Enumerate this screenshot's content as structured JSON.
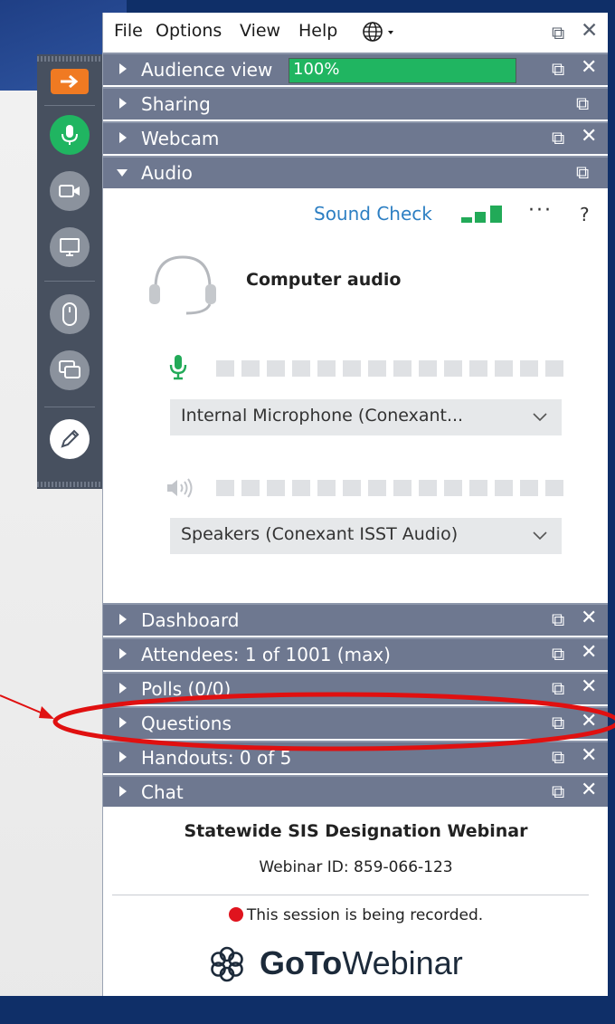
{
  "menubar": {
    "items": [
      "File",
      "Options",
      "View",
      "Help"
    ],
    "language_icon": "globe-icon",
    "popout_icon": "popout-icon",
    "close_icon": "close-icon"
  },
  "sections": {
    "audience_view": {
      "label": "Audience view",
      "percent_text": "100%",
      "percent_value": 100
    },
    "sharing": {
      "label": "Sharing"
    },
    "webcam": {
      "label": "Webcam"
    },
    "audio": {
      "label": "Audio"
    },
    "dashboard": {
      "label": "Dashboard"
    },
    "attendees": {
      "label": "Attendees:  1 of 1001 (max)"
    },
    "polls": {
      "label": "Polls (0/0)"
    },
    "questions": {
      "label": "Questions"
    },
    "handouts": {
      "label": "Handouts: 0 of 5"
    },
    "chat": {
      "label": "Chat"
    }
  },
  "audio": {
    "sound_check_label": "Sound Check",
    "more_label": "···",
    "help_label": "?",
    "mode_label": "Computer audio",
    "microphone_value": "Internal  Microphone  (Conexant...",
    "speakers_value": "Speakers (Conexant ISST Audio)"
  },
  "toolbar": {
    "buttons": [
      "collapse-arrow-icon",
      "microphone-icon",
      "webcam-icon",
      "screen-share-icon",
      "mouse-icon",
      "chat-bubbles-icon",
      "pen-icon"
    ]
  },
  "footer": {
    "webinar_title": "Statewide SIS Designation Webinar",
    "webinar_id": "Webinar ID: 859-066-123",
    "recording_text": "This session is being recorded.",
    "logo_bold": "GoTo",
    "logo_regular": "Webinar"
  },
  "colors": {
    "accent_green": "#20b561",
    "header_gray": "#6e7890",
    "recording_red": "#e0141e",
    "annotation_red": "#e01010",
    "link_blue": "#2d7fc3",
    "orange": "#f07a22"
  }
}
